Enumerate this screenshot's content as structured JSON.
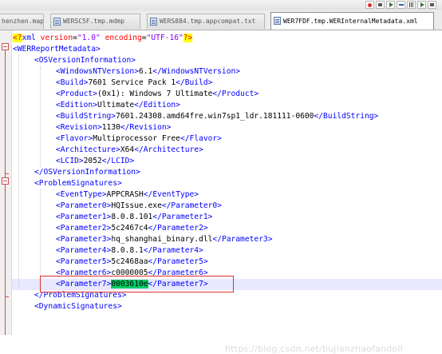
{
  "toolbar": {
    "buttons": [
      "record-icon",
      "stop-icon",
      "play-icon",
      "playback-icon",
      "save-macro-icon",
      "run-macro-icon",
      "show-whitespace-icon"
    ]
  },
  "tabs": [
    {
      "label": "henzhen.map",
      "active": false
    },
    {
      "label": "WERSC5F.tmp.mdmp",
      "active": false
    },
    {
      "label": "WERS884.tmp.appcompat.txt",
      "active": false
    },
    {
      "label": "WER7FDF.tmp.WERInternalMetadata.xml",
      "active": true
    }
  ],
  "editor": {
    "lines": [
      {
        "indent": 0,
        "parts": [
          [
            "pi",
            "<?"
          ],
          [
            "tag",
            "xml "
          ],
          [
            "attr",
            "version"
          ],
          [
            "txt",
            "="
          ],
          [
            "str",
            "\"1.0\""
          ],
          [
            "txt",
            " "
          ],
          [
            "attr",
            "encoding"
          ],
          [
            "txt",
            "="
          ],
          [
            "str",
            "\"UTF-16\""
          ],
          [
            "pi",
            "?>"
          ]
        ]
      },
      {
        "indent": 0,
        "parts": [
          [
            "tag",
            "<WERReportMetadata>"
          ]
        ]
      },
      {
        "indent": 1,
        "parts": [
          [
            "tag",
            "<OSVersionInformation>"
          ]
        ]
      },
      {
        "indent": 2,
        "parts": [
          [
            "tag",
            "<WindowsNTVersion>"
          ],
          [
            "txt",
            "6.1"
          ],
          [
            "tag",
            "</WindowsNTVersion>"
          ]
        ]
      },
      {
        "indent": 2,
        "parts": [
          [
            "tag",
            "<Build>"
          ],
          [
            "txt",
            "7601 Service Pack 1"
          ],
          [
            "tag",
            "</Build>"
          ]
        ]
      },
      {
        "indent": 2,
        "parts": [
          [
            "tag",
            "<Product>"
          ],
          [
            "txt",
            "(0x1): Windows 7 Ultimate"
          ],
          [
            "tag",
            "</Product>"
          ]
        ]
      },
      {
        "indent": 2,
        "parts": [
          [
            "tag",
            "<Edition>"
          ],
          [
            "txt",
            "Ultimate"
          ],
          [
            "tag",
            "</Edition>"
          ]
        ]
      },
      {
        "indent": 2,
        "parts": [
          [
            "tag",
            "<BuildString>"
          ],
          [
            "txt",
            "7601.24308.amd64fre.win7sp1_ldr.181111-0600"
          ],
          [
            "tag",
            "</BuildString>"
          ]
        ]
      },
      {
        "indent": 2,
        "parts": [
          [
            "tag",
            "<Revision>"
          ],
          [
            "txt",
            "1130"
          ],
          [
            "tag",
            "</Revision>"
          ]
        ]
      },
      {
        "indent": 2,
        "parts": [
          [
            "tag",
            "<Flavor>"
          ],
          [
            "txt",
            "Multiprocessor Free"
          ],
          [
            "tag",
            "</Flavor>"
          ]
        ]
      },
      {
        "indent": 2,
        "parts": [
          [
            "tag",
            "<Architecture>"
          ],
          [
            "txt",
            "X64"
          ],
          [
            "tag",
            "</Architecture>"
          ]
        ]
      },
      {
        "indent": 2,
        "parts": [
          [
            "tag",
            "<LCID>"
          ],
          [
            "txt",
            "2052"
          ],
          [
            "tag",
            "</LCID>"
          ]
        ]
      },
      {
        "indent": 1,
        "parts": [
          [
            "tag",
            "</OSVersionInformation>"
          ]
        ]
      },
      {
        "indent": 1,
        "parts": [
          [
            "tag",
            "<ProblemSignatures>"
          ]
        ]
      },
      {
        "indent": 2,
        "parts": [
          [
            "tag",
            "<EventType>"
          ],
          [
            "txt",
            "APPCRASH"
          ],
          [
            "tag",
            "</EventType>"
          ]
        ]
      },
      {
        "indent": 2,
        "parts": [
          [
            "tag",
            "<Parameter0>"
          ],
          [
            "txt",
            "HQIssue.exe"
          ],
          [
            "tag",
            "</Parameter0>"
          ]
        ]
      },
      {
        "indent": 2,
        "parts": [
          [
            "tag",
            "<Parameter1>"
          ],
          [
            "txt",
            "8.0.8.101"
          ],
          [
            "tag",
            "</Parameter1>"
          ]
        ]
      },
      {
        "indent": 2,
        "parts": [
          [
            "tag",
            "<Parameter2>"
          ],
          [
            "txt",
            "5c2467c4"
          ],
          [
            "tag",
            "</Parameter2>"
          ]
        ]
      },
      {
        "indent": 2,
        "parts": [
          [
            "tag",
            "<Parameter3>"
          ],
          [
            "txt",
            "hq_shanghai_binary.dll"
          ],
          [
            "tag",
            "</Parameter3>"
          ]
        ]
      },
      {
        "indent": 2,
        "parts": [
          [
            "tag",
            "<Parameter4>"
          ],
          [
            "txt",
            "8.0.8.1"
          ],
          [
            "tag",
            "</Parameter4>"
          ]
        ]
      },
      {
        "indent": 2,
        "parts": [
          [
            "tag",
            "<Parameter5>"
          ],
          [
            "txt",
            "5c2468aa"
          ],
          [
            "tag",
            "</Parameter5>"
          ]
        ]
      },
      {
        "indent": 2,
        "parts": [
          [
            "tag",
            "<Parameter6>"
          ],
          [
            "txt",
            "c0000005"
          ],
          [
            "tag",
            "</Parameter6>"
          ]
        ]
      },
      {
        "indent": 2,
        "current": true,
        "parts": [
          [
            "tag",
            "<Parameter7>"
          ],
          [
            "hl",
            "0003610e"
          ],
          [
            "tag",
            "</Parameter7>"
          ]
        ]
      },
      {
        "indent": 1,
        "parts": [
          [
            "tag",
            "</ProblemSignatures>"
          ]
        ]
      },
      {
        "indent": 1,
        "parts": [
          [
            "tag",
            "<DynamicSignatures>"
          ]
        ]
      }
    ]
  },
  "watermark": "https://blog.csdn.net/bujianzhaofandoll",
  "colors": {
    "tag": "#0000ff",
    "attribute": "#ff0000",
    "attribute_value": "#8000ff",
    "highlight": "#00cc66",
    "annotation_box": "#e03030"
  }
}
